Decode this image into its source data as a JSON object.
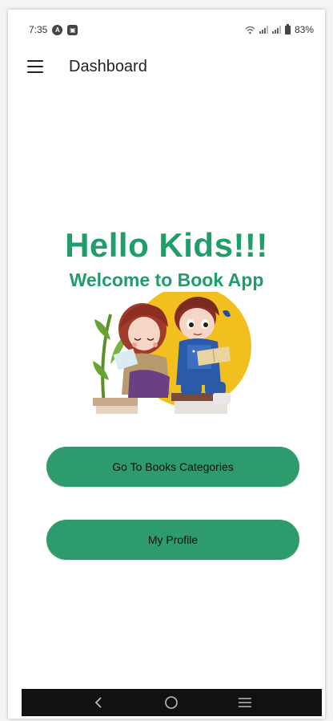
{
  "status_bar": {
    "time": "7:35",
    "battery_percent": "83%"
  },
  "app_bar": {
    "title": "Dashboard"
  },
  "main": {
    "greeting": "Hello Kids!!!",
    "welcome": "Welcome to Book App",
    "buttons": {
      "categories": "Go To Books Categories",
      "profile": "My Profile"
    }
  },
  "colors": {
    "accent_text": "#1f9e6a",
    "button_bg": "#2e9b6c"
  },
  "icons": {
    "menu": "hamburger-menu-icon",
    "nav_back": "back-chevron-icon",
    "nav_home": "home-circle-icon",
    "nav_recents": "recents-lines-icon"
  }
}
